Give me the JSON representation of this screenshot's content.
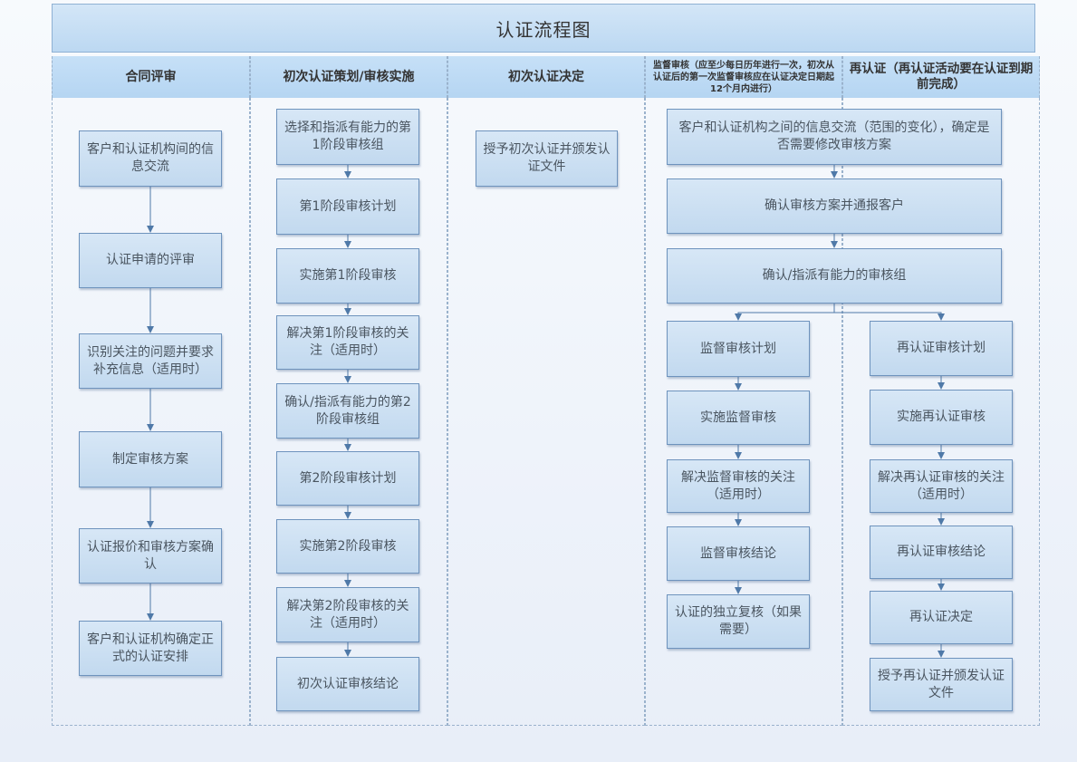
{
  "title": "认证流程图",
  "columns": [
    "合同评审",
    "初次认证策划/审核实施",
    "初次认证决定",
    "监督审核（应至少每日历年进行一次，初次从认证后的第一次监督审核应在认证决定日期起12个月内进行）",
    "再认证（再认证活动要在认证到期前完成）"
  ],
  "col1": [
    "客户和认证机构间的信息交流",
    "认证申请的评审",
    "识别关注的问题并要求补充信息（适用时）",
    "制定审核方案",
    "认证报价和审核方案确认",
    "客户和认证机构确定正式的认证安排"
  ],
  "col2": [
    "选择和指派有能力的第1阶段审核组",
    "第1阶段审核计划",
    "实施第1阶段审核",
    "解决第1阶段审核的关注（适用时）",
    "确认/指派有能力的第2阶段审核组",
    "第2阶段审核计划",
    "实施第2阶段审核",
    "解决第2阶段审核的关注（适用时）",
    "初次认证审核结论"
  ],
  "col3": [
    "授予初次认证并颁发认证文件"
  ],
  "shared": [
    "客户和认证机构之间的信息交流（范围的变化），确定是否需要修改审核方案",
    "确认审核方案并通报客户",
    "确认/指派有能力的审核组"
  ],
  "col4": [
    "监督审核计划",
    "实施监督审核",
    "解决监督审核的关注（适用时）",
    "监督审核结论",
    "认证的独立复核（如果需要）"
  ],
  "col5": [
    "再认证审核计划",
    "实施再认证审核",
    "解决再认证审核的关注（适用时）",
    "再认证审核结论",
    "再认证决定",
    "授予再认证并颁发认证文件"
  ]
}
